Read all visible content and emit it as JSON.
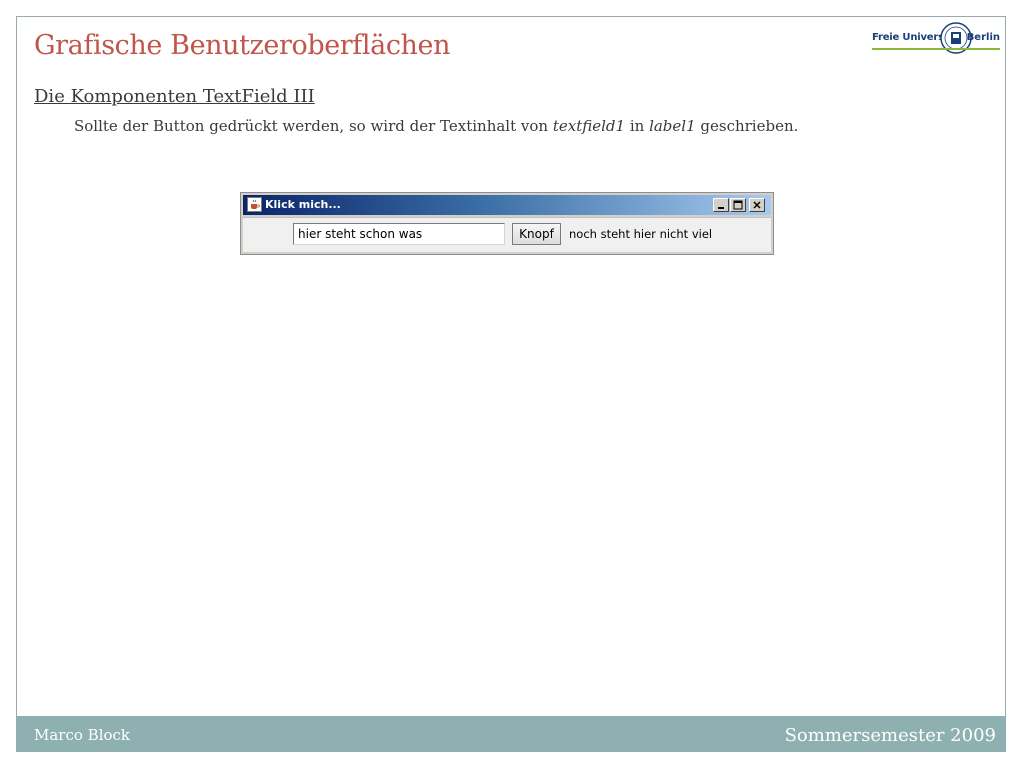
{
  "slide": {
    "title": "Grafische Benutzeroberflächen",
    "subtitle": "Die Komponenten TextField III",
    "body": {
      "part1": "Sollte der Button gedrückt werden, so wird der Textinhalt von ",
      "italic1": "textfield1",
      "part2": " in ",
      "italic2": "label1",
      "part3": " geschrieben."
    }
  },
  "logo": {
    "left_text": "Freie Universität",
    "right_text": "Berlin",
    "seal_icon": "university-seal-icon",
    "colors": {
      "text": "#1b3f7a",
      "line": "#8ab83a"
    }
  },
  "window": {
    "title": "Klick mich...",
    "app_icon": "java-cup-icon",
    "controls": {
      "minimize": "minimize-icon",
      "maximize": "maximize-icon",
      "close": "close-icon"
    },
    "textfield_value": "hier steht schon was",
    "button_label": "Knopf",
    "label_text": "noch steht hier nicht viel"
  },
  "footer": {
    "author": "Marco Block",
    "semester": "Sommersemester 2009",
    "color": "#8eb0b0"
  },
  "colors": {
    "title": "#c0564a",
    "text": "#3a3a3a"
  }
}
